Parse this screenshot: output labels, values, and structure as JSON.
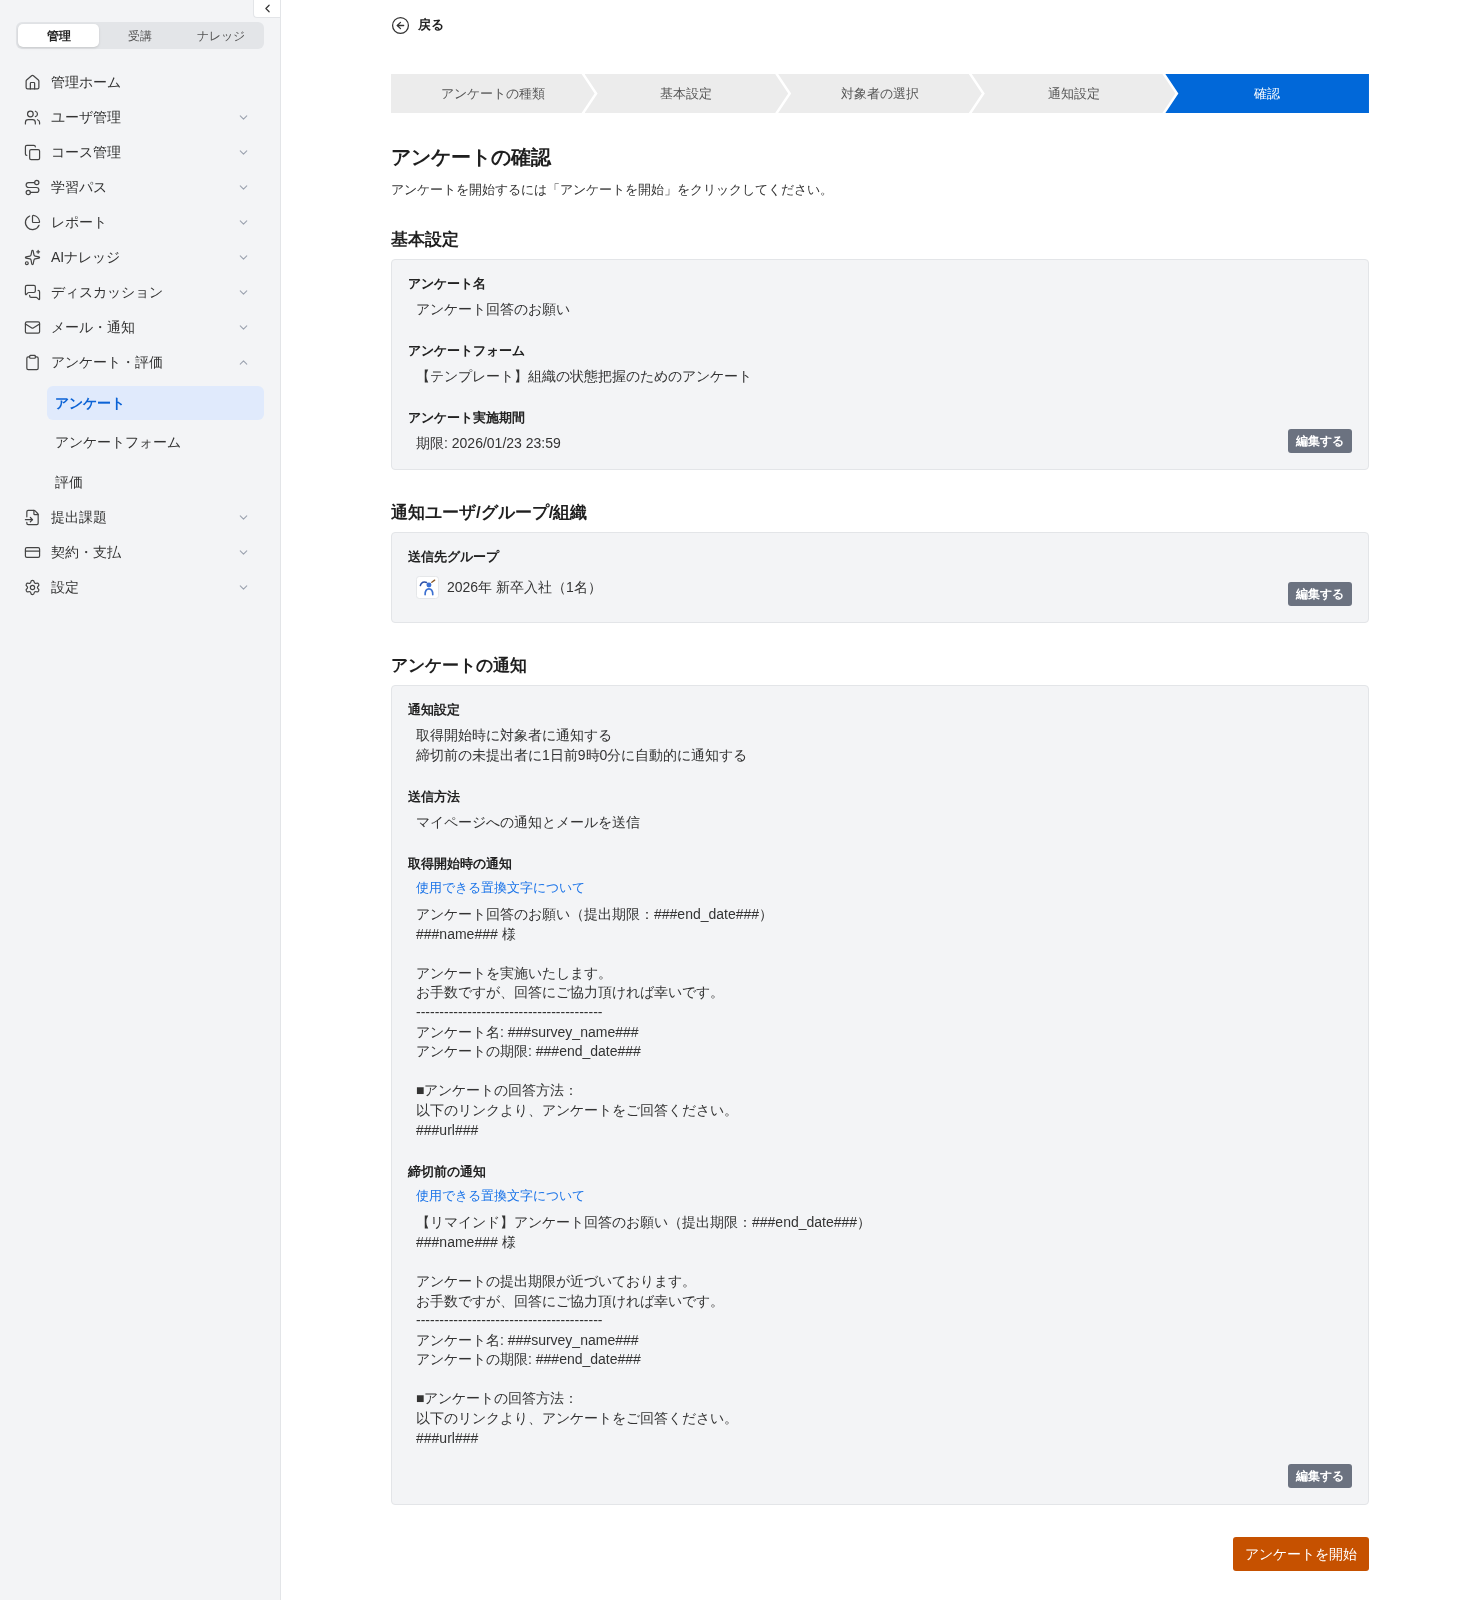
{
  "sidebar": {
    "mode_tabs": [
      {
        "label": "管理",
        "selected": true
      },
      {
        "label": "受講",
        "selected": false
      },
      {
        "label": "ナレッジ",
        "selected": false
      }
    ],
    "nav_items": [
      {
        "label": "管理ホーム"
      },
      {
        "label": "ユーザ管理",
        "expanded": false
      },
      {
        "label": "コース管理",
        "expanded": false
      },
      {
        "label": "学習パス",
        "expanded": false
      },
      {
        "label": "レポート",
        "expanded": false
      },
      {
        "label": "AIナレッジ",
        "expanded": false
      },
      {
        "label": "ディスカッション",
        "expanded": false
      },
      {
        "label": "メール・通知",
        "expanded": false
      },
      {
        "label": "アンケート・評価",
        "expanded": true,
        "children": [
          {
            "label": "アンケート",
            "selected": true
          },
          {
            "label": "アンケートフォーム",
            "selected": false
          },
          {
            "label": "評価",
            "selected": false
          }
        ]
      },
      {
        "label": "提出課題",
        "expanded": false
      },
      {
        "label": "契約・支払",
        "expanded": false
      },
      {
        "label": "設定",
        "expanded": false
      }
    ]
  },
  "back_link": {
    "label": "戻る"
  },
  "steps": [
    {
      "label": "アンケートの種類",
      "selected": false
    },
    {
      "label": "基本設定",
      "selected": false
    },
    {
      "label": "対象者の選択",
      "selected": false
    },
    {
      "label": "通知設定",
      "selected": false
    },
    {
      "label": "確認",
      "selected": true
    }
  ],
  "page_title": "アンケートの確認",
  "description": "アンケートを開始するには「アンケートを開始」をクリックしてください。",
  "sections": [
    {
      "title": "基本設定",
      "fields": [
        {
          "kind": "text",
          "label": "アンケート名",
          "value": "アンケート回答のお願い"
        },
        {
          "kind": "text",
          "label": "アンケートフォーム",
          "value": "【テンプレート】組織の状態把握のためのアンケート"
        },
        {
          "kind": "text",
          "label": "アンケート実施期間",
          "value": "期限: 2026/01/23 23:59"
        }
      ],
      "edit_button": "編集する"
    },
    {
      "title": "通知ユーザ/グループ/組織",
      "fields": [
        {
          "kind": "group",
          "label": "送信先グループ",
          "value": "2026年 新卒入社（1名）"
        }
      ],
      "edit_button": "編集する"
    },
    {
      "title": "アンケートの通知",
      "fields": [
        {
          "kind": "lines",
          "label": "通知設定",
          "lines": [
            "取得開始時に対象者に通知する",
            "締切前の未提出者に1日前9時0分に自動的に通知する"
          ]
        },
        {
          "kind": "text",
          "label": "送信方法",
          "value": "マイページへの通知とメールを送信"
        },
        {
          "kind": "template",
          "label": "取得開始時の通知",
          "link": "使用できる置換文字について",
          "paragraphs": [
            [
              "アンケート回答のお願い（提出期限：###end_date###）",
              "###name### 様"
            ],
            [
              "アンケートを実施いたします。",
              "お手数ですが、回答にご協力頂ければ幸いです。",
              "----------------------------------------",
              "アンケート名: ###survey_name###",
              "アンケートの期限: ###end_date###"
            ],
            [
              "■アンケートの回答方法：",
              "以下のリンクより、アンケートをご回答ください。",
              "###url###"
            ]
          ]
        },
        {
          "kind": "template",
          "label": "締切前の通知",
          "link": "使用できる置換文字について",
          "paragraphs": [
            [
              "【リマインド】アンケート回答のお願い（提出期限：###end_date###）",
              "###name### 様"
            ],
            [
              "アンケートの提出期限が近づいております。",
              "お手数ですが、回答にご協力頂ければ幸いです。",
              "----------------------------------------",
              "アンケート名: ###survey_name###",
              "アンケートの期限: ###end_date###"
            ],
            [
              "■アンケートの回答方法：",
              "以下のリンクより、アンケートをご回答ください。",
              "###url###"
            ]
          ]
        }
      ],
      "edit_button": "編集する"
    }
  ],
  "start_button": "アンケートを開始"
}
